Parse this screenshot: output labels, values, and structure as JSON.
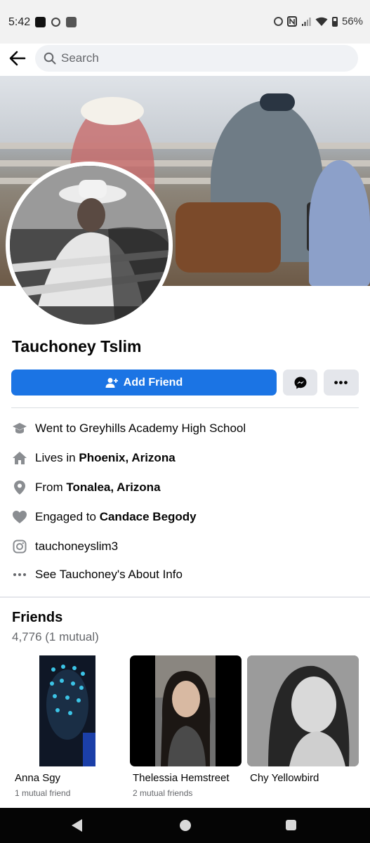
{
  "status_bar": {
    "time": "5:42",
    "battery": "56%"
  },
  "search": {
    "placeholder": "Search"
  },
  "profile": {
    "name": "Tauchoney Tslim"
  },
  "actions": {
    "add_friend_label": "Add Friend",
    "more_label": "•••"
  },
  "intro": {
    "education": "Went to Greyhills Academy High School",
    "lives_prefix": "Lives in ",
    "lives_place": "Phoenix, Arizona",
    "from_prefix": "From ",
    "from_place": "Tonalea, Arizona",
    "engaged_prefix": "Engaged to ",
    "engaged_name": "Candace Begody",
    "instagram": "tauchoneyslim3",
    "about_link": "See Tauchoney's About Info"
  },
  "friends": {
    "title": "Friends",
    "count": "4,776 (1 mutual)",
    "items": [
      {
        "name": "Anna Sgy",
        "mutual": "1 mutual friend"
      },
      {
        "name": "Thelessia Hemstreet",
        "mutual": "2 mutual friends"
      },
      {
        "name": "Chy Yellowbird",
        "mutual": ""
      }
    ]
  },
  "colors": {
    "primary": "#1b74e4",
    "secondary_button": "#e4e6eb",
    "muted_text": "#65676b"
  }
}
